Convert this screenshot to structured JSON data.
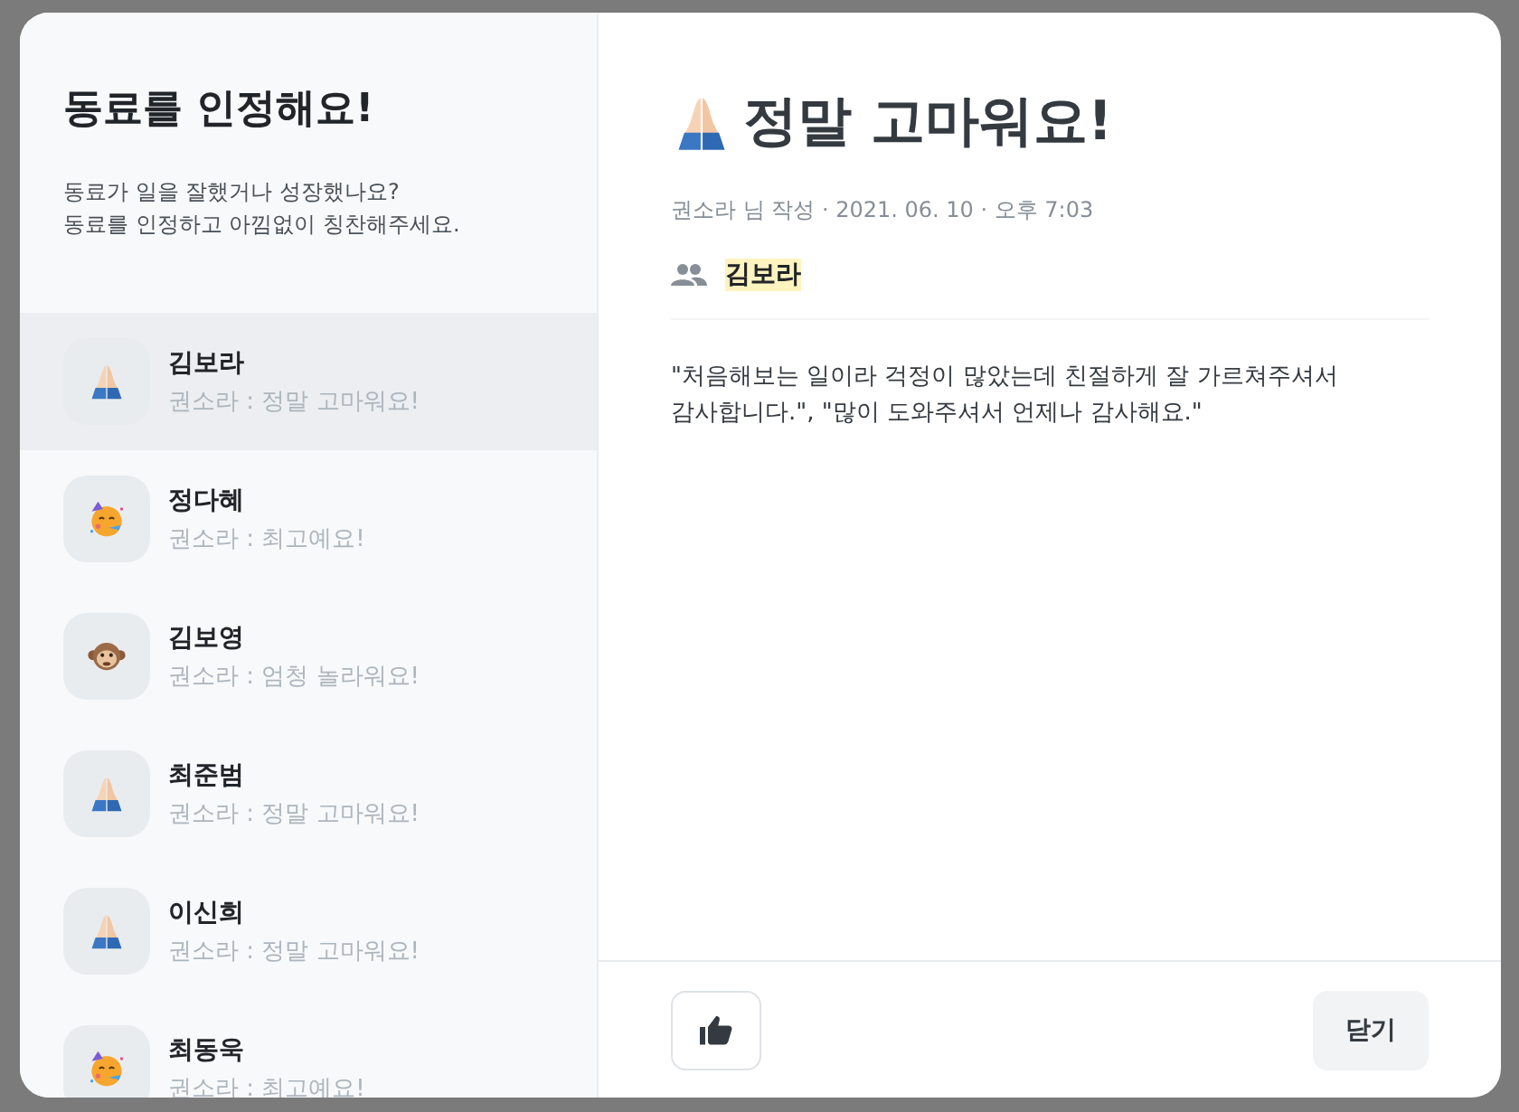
{
  "sidebar": {
    "title": "동료를 인정해요!",
    "subtitle_lines": [
      "동료가 일을 잘했거나 성장했나요?",
      "동료를 인정하고 아낌없이 칭찬해주세요."
    ]
  },
  "list": [
    {
      "name": "김보라",
      "message": "권소라 : 정말 고마워요!",
      "kind": "pray",
      "selected": true
    },
    {
      "name": "정다혜",
      "message": "권소라 : 최고예요!",
      "kind": "party",
      "selected": false
    },
    {
      "name": "김보영",
      "message": "권소라 : 엄청 놀라워요!",
      "kind": "monkey",
      "selected": false
    },
    {
      "name": "최준범",
      "message": "권소라 : 정말 고마워요!",
      "kind": "pray",
      "selected": false
    },
    {
      "name": "이신희",
      "message": "권소라 : 정말 고마워요!",
      "kind": "pray",
      "selected": false
    },
    {
      "name": "최동욱",
      "message": "권소라 : 최고예요!",
      "kind": "party",
      "selected": false
    }
  ],
  "detail": {
    "kind": "pray",
    "title": "정말 고마워요!",
    "meta": "권소라 님 작성 · 2021. 06. 10 · 오후 7:03",
    "recipient": "김보라",
    "message": "\"처음해보는 일이라 걱정이 많았는데 친절하게 잘 가르쳐주셔서 감사합니다.\", \"많이 도와주셔서 언제나 감사해요.\""
  },
  "footer": {
    "close_label": "닫기"
  }
}
